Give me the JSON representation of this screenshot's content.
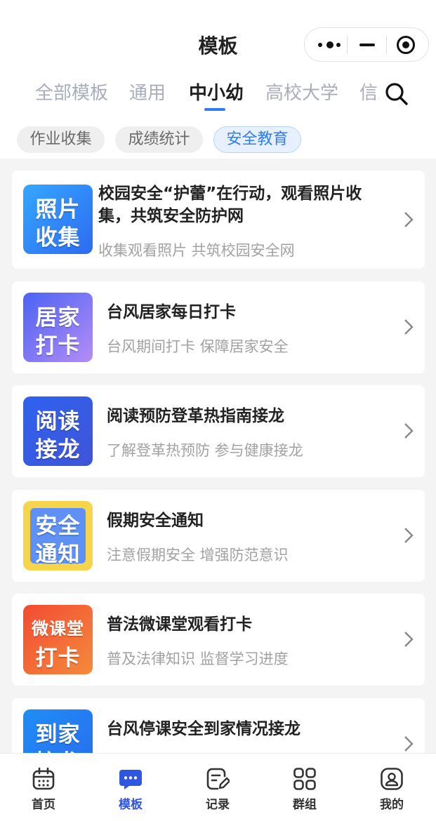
{
  "header": {
    "title": "模板",
    "capsule": {
      "more_icon": "more-dots-icon",
      "minimize_icon": "minus-icon",
      "close_icon": "target-icon"
    }
  },
  "tabs": [
    {
      "label": "全部模板"
    },
    {
      "label": "通用"
    },
    {
      "label": "中小幼",
      "active": true
    },
    {
      "label": "高校大学"
    },
    {
      "label": "信息"
    }
  ],
  "search_icon": "search-icon",
  "chips": [
    {
      "label": "作业收集"
    },
    {
      "label": "成绩统计"
    },
    {
      "label": "安全教育",
      "active": true
    }
  ],
  "cards": [
    {
      "thumb_line1": "照片",
      "thumb_line2": "收集",
      "title": "校园安全“护蕾”在行动，观看照片收集，共筑安全防护网",
      "subtitle": "收集观看照片 共筑校园安全网"
    },
    {
      "thumb_line1": "居家",
      "thumb_line2": "打卡",
      "title": "台风居家每日打卡",
      "subtitle": "台风期间打卡 保障居家安全"
    },
    {
      "thumb_line1": "阅读",
      "thumb_line2": "接龙",
      "title": "阅读预防登革热指南接龙",
      "subtitle": "了解登革热预防 参与健康接龙"
    },
    {
      "thumb_line1": "安全",
      "thumb_line2": "通知",
      "title": "假期安全通知",
      "subtitle": "注意假期安全 增强防范意识"
    },
    {
      "thumb_line1": "微课堂",
      "thumb_line2": "打卡",
      "title": "普法微课堂观看打卡",
      "subtitle": "普及法律知识 监督学习进度"
    },
    {
      "thumb_line1": "到家",
      "thumb_line2": "接龙",
      "title": "台风停课安全到家情况接龙",
      "subtitle": ""
    }
  ],
  "bottom_nav": [
    {
      "label": "首页",
      "icon": "calendar-icon"
    },
    {
      "label": "模板",
      "icon": "chat-bubble-icon",
      "active": true
    },
    {
      "label": "记录",
      "icon": "edit-note-icon"
    },
    {
      "label": "群组",
      "icon": "grid-icon"
    },
    {
      "label": "我的",
      "icon": "user-icon"
    }
  ],
  "colors": {
    "accent": "#2f7cf6",
    "nav_active": "#2f56e0",
    "background": "#f4f4f5"
  }
}
